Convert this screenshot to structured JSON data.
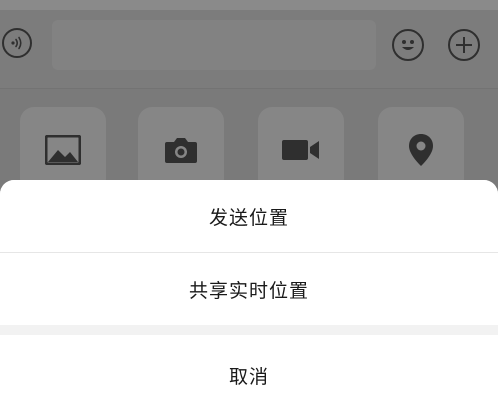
{
  "colors": {
    "overlay_background": "#7f7f7f",
    "sheet_background": "#f2f2f2",
    "option_background": "#ffffff",
    "text": "#1a1a1a",
    "icon_dark": "#2f2f2f"
  },
  "input_bar": {
    "icons": [
      "voice-icon",
      "emoji-icon",
      "plus-icon"
    ]
  },
  "panel": {
    "tiles": [
      "photo-icon",
      "camera-icon",
      "video-call-icon",
      "location-icon"
    ]
  },
  "action_sheet": {
    "send_location_label": "发送位置",
    "share_live_location_label": "共享实时位置",
    "cancel_label": "取消"
  }
}
